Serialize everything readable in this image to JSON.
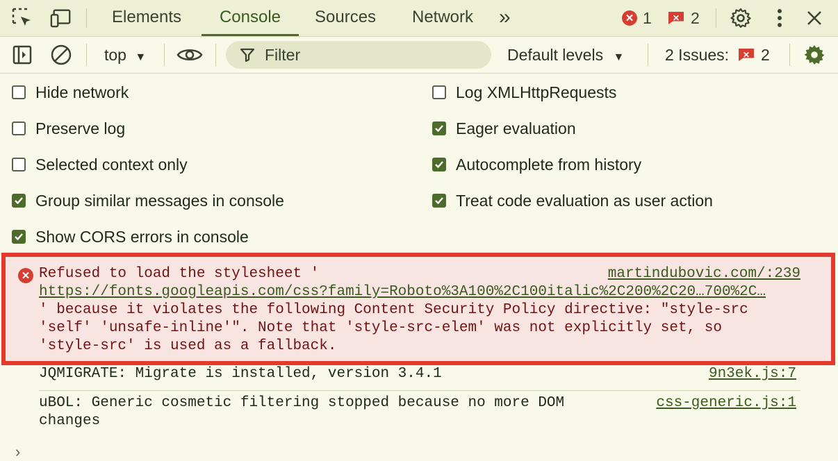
{
  "tabbar": {
    "tabs": [
      {
        "label": "Elements"
      },
      {
        "label": "Console"
      },
      {
        "label": "Sources"
      },
      {
        "label": "Network"
      }
    ],
    "more_glyph": "»",
    "error_count": "1",
    "issue_count": "2"
  },
  "toolbar": {
    "context": "top",
    "filter_placeholder": "Filter",
    "levels": "Default levels",
    "issues_label": "2 Issues:",
    "issues_count": "2"
  },
  "settings": {
    "left": [
      {
        "label": "Hide network",
        "checked": false
      },
      {
        "label": "Preserve log",
        "checked": false
      },
      {
        "label": "Selected context only",
        "checked": false
      },
      {
        "label": "Group similar messages in console",
        "checked": true
      },
      {
        "label": "Show CORS errors in console",
        "checked": true
      }
    ],
    "right": [
      {
        "label": "Log XMLHttpRequests",
        "checked": false
      },
      {
        "label": "Eager evaluation",
        "checked": true
      },
      {
        "label": "Autocomplete from history",
        "checked": true
      },
      {
        "label": "Treat code evaluation as user action",
        "checked": true
      }
    ]
  },
  "console": {
    "error": {
      "line1": "Refused to load the stylesheet '",
      "url": "https://fonts.googleapis.com/css?family=Roboto%3A100%2C100italic%2C200%2C20…700%2C…",
      "line3": "' because it violates the following Content Security Policy directive: \"style-src",
      "line4": "'self' 'unsafe-inline'\". Note that 'style-src-elem' was not explicitly set, so",
      "line5": "'style-src' is used as a fallback.",
      "source": "martindubovic.com/:239"
    },
    "logs": [
      {
        "text": "JQMIGRATE: Migrate is installed, version 3.4.1",
        "source": "9n3ek.js:7"
      },
      {
        "text": "uBOL: Generic cosmetic filtering stopped because no more DOM",
        "text2": "changes",
        "source": "css-generic.js:1"
      }
    ],
    "prompt": "›"
  },
  "colors": {
    "accent": "#4d6b2a",
    "error": "#d63d33",
    "error_bg": "#f8e5e2",
    "highlight_border": "#e5392e"
  }
}
